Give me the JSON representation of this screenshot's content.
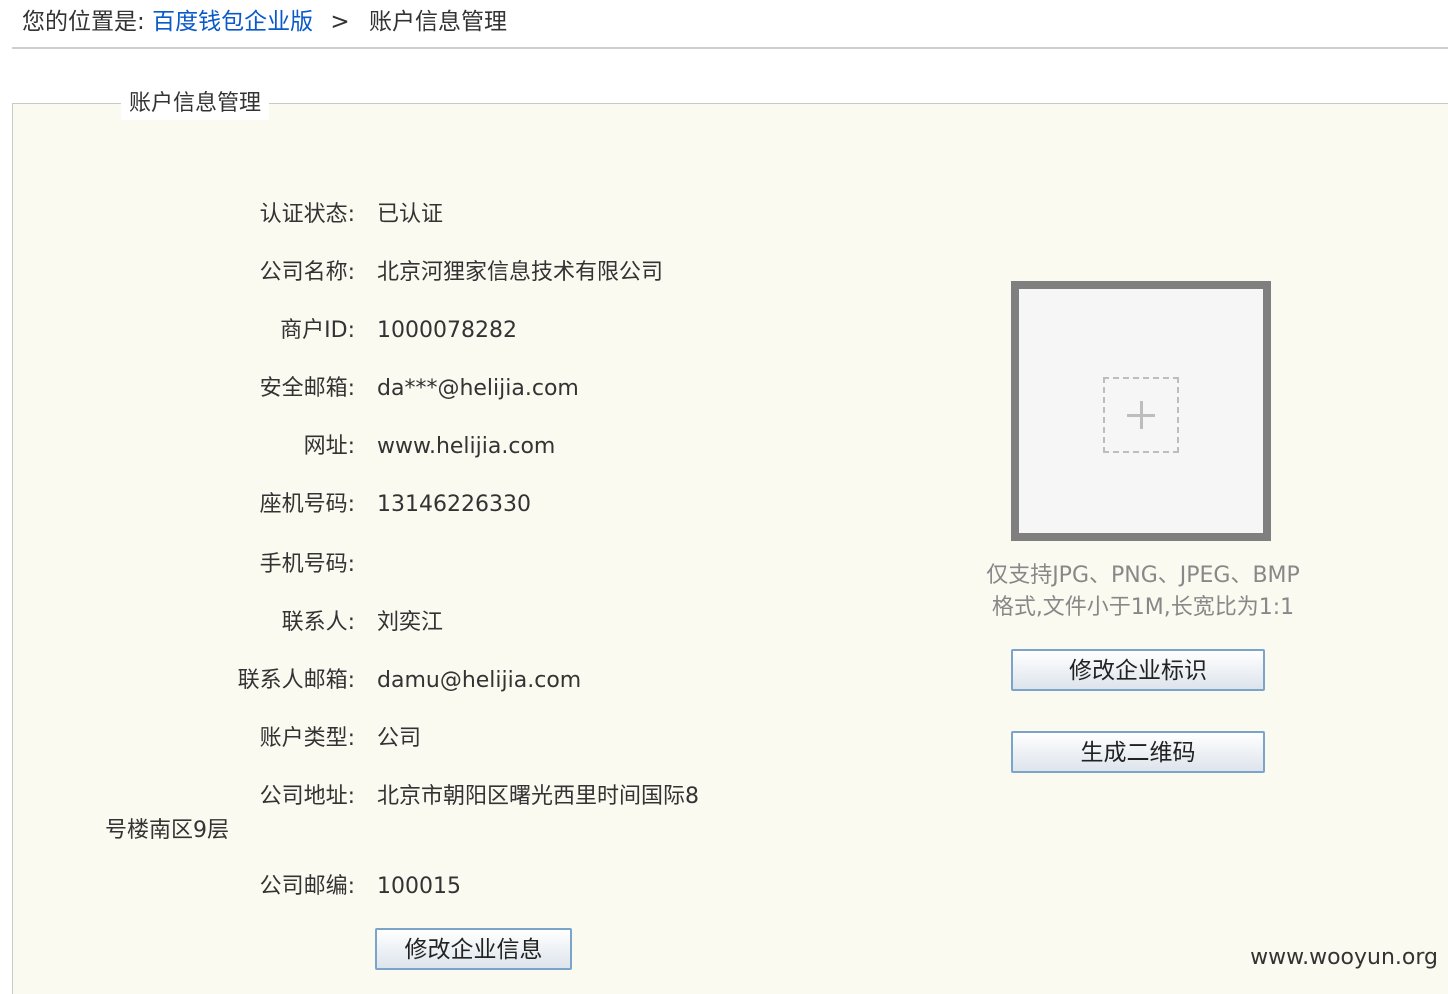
{
  "breadcrumb": {
    "prefix": "您的位置是:",
    "home": "百度钱包企业版",
    "separator": ">",
    "current": "账户信息管理"
  },
  "panel": {
    "title": "账户信息管理"
  },
  "fields": {
    "auth_status": {
      "label": "认证状态:",
      "value": "已认证"
    },
    "company_name": {
      "label": "公司名称:",
      "value": "北京河狸家信息技术有限公司"
    },
    "merchant_id": {
      "label": "商户ID:",
      "value": "1000078282"
    },
    "security_email": {
      "label": "安全邮箱:",
      "value": "da***@helijia.com"
    },
    "website": {
      "label": "网址:",
      "value": "www.helijia.com"
    },
    "landline": {
      "label": "座机号码:",
      "value": "13146226330"
    },
    "mobile": {
      "label": "手机号码:",
      "value": ""
    },
    "contact": {
      "label": "联系人:",
      "value": "刘奕江"
    },
    "contact_email": {
      "label": "联系人邮箱:",
      "value": "damu@helijia.com"
    },
    "account_type": {
      "label": "账户类型:",
      "value": "公司"
    },
    "address": {
      "label": "公司地址:",
      "value_line1": "北京市朝阳区曙光西里时间国际8",
      "value_line2": "号楼南区9层"
    },
    "postcode": {
      "label": "公司邮编:",
      "value": "100015"
    }
  },
  "buttons": {
    "edit_info": "修改企业信息",
    "edit_logo": "修改企业标识",
    "gen_qr": "生成二维码"
  },
  "logo": {
    "hint_line1": "仅支持JPG、PNG、JPEG、BMP",
    "hint_line2": "格式,文件小于1M,长宽比为1:1"
  },
  "watermark": "www.wooyun.org",
  "colors": {
    "link": "#0a59c8",
    "panel_bg": "#fafaf1",
    "button_border": "#7aa4c9"
  }
}
